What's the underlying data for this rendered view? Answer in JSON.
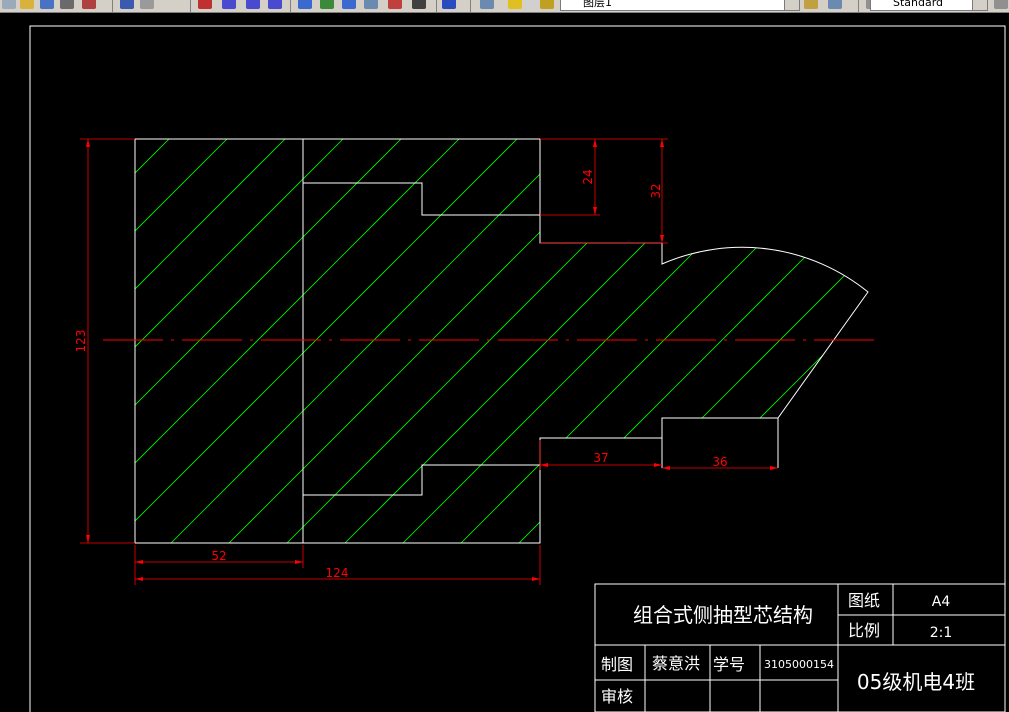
{
  "toolbar": {
    "layer_name": "图层1",
    "text_style": "Standard"
  },
  "drawing": {
    "dimensions": {
      "d24": "24",
      "d32": "32",
      "d123": "123",
      "d37": "37",
      "d36": "36",
      "d52": "52",
      "d124": "124"
    },
    "colors": {
      "outline": "#ffffff",
      "hatch": "#00ff00",
      "dimension": "#ff0000",
      "background": "#000000"
    }
  },
  "title_block": {
    "part_name": "组合式侧抽型芯结构",
    "sheet_label": "图纸",
    "sheet_value": "A4",
    "scale_label": "比例",
    "scale_value": "2:1",
    "drawn_label": "制图",
    "drawn_by": "蔡意洪",
    "student_no_label": "学号",
    "student_no": "3105000154",
    "review_label": "审核",
    "class_name": "05级机电4班"
  }
}
